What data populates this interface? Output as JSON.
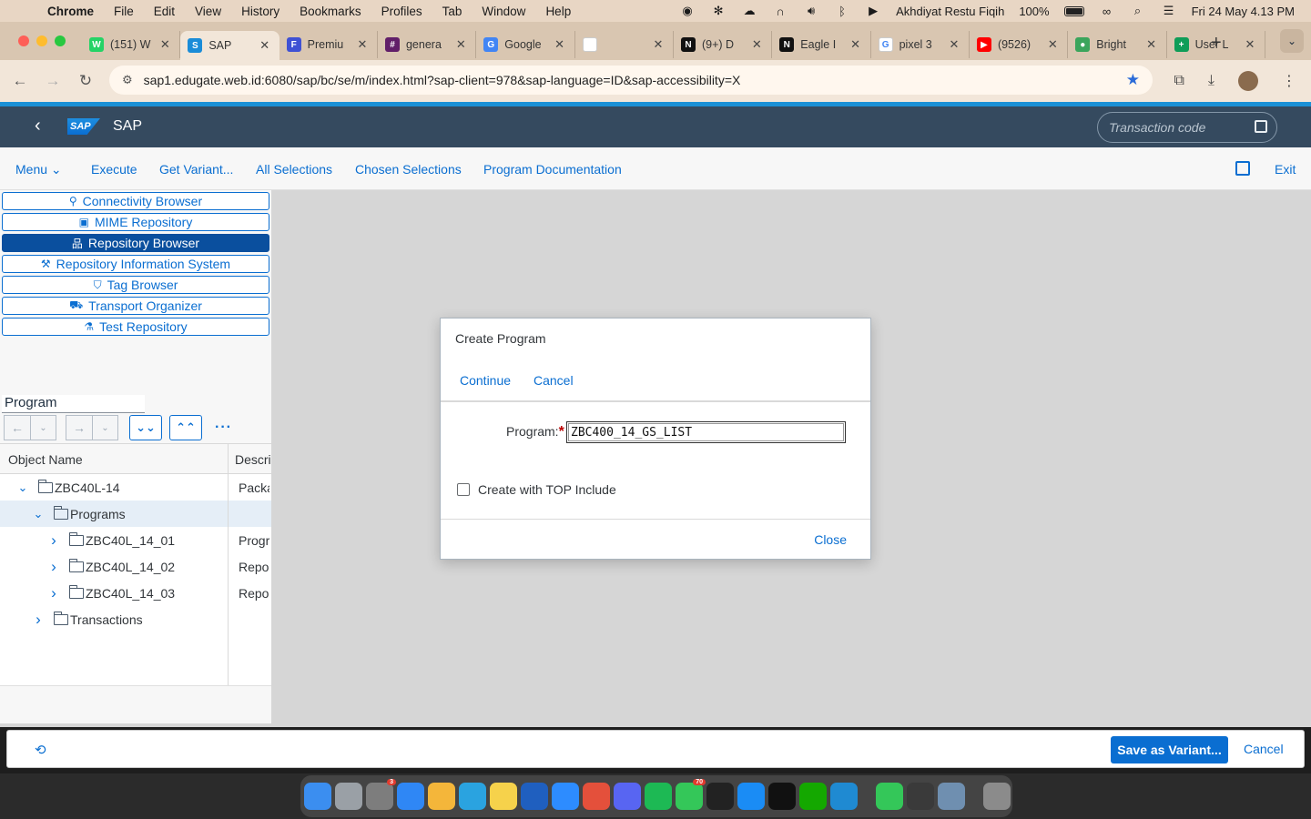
{
  "macos": {
    "menu": [
      "Chrome",
      "File",
      "Edit",
      "View",
      "History",
      "Bookmarks",
      "Profiles",
      "Tab",
      "Window",
      "Help"
    ],
    "user": "Akhdiyat Restu Fiqih",
    "battery": "100%",
    "datetime": "Fri 24 May  4.13 PM"
  },
  "browser": {
    "tabs": [
      {
        "title": "(151) W",
        "color": "#25d366",
        "glyph": "W"
      },
      {
        "title": "SAP",
        "color": "#1a8cd8",
        "glyph": "S"
      },
      {
        "title": "Premiu",
        "color": "#3f51d4",
        "glyph": "F"
      },
      {
        "title": "genera",
        "color": "#611f69",
        "glyph": "#"
      },
      {
        "title": "Google",
        "color": "#4285f4",
        "glyph": "G"
      },
      {
        "title": "",
        "color": "#ffffff",
        "glyph": ""
      },
      {
        "title": "(9+) D",
        "color": "#111111",
        "glyph": "N"
      },
      {
        "title": "Eagle I",
        "color": "#111111",
        "glyph": "N"
      },
      {
        "title": "pixel 3",
        "color": "#ffffff",
        "glyph": "G"
      },
      {
        "title": "(9526)",
        "color": "#ff0000",
        "glyph": "▶"
      },
      {
        "title": "Bright",
        "color": "#3ba55c",
        "glyph": "●"
      },
      {
        "title": "User L",
        "color": "#0f9d58",
        "glyph": "+"
      }
    ],
    "active_tab": 1,
    "url": "sap1.edugate.web.id:6080/sap/bc/se/m/index.html?sap-client=978&sap-language=ID&sap-accessibility=X"
  },
  "shell": {
    "logo": "SAP",
    "title": "SAP",
    "tcode_placeholder": "Transaction code"
  },
  "toolbar": {
    "menu": "Menu",
    "execute": "Execute",
    "get_variant": "Get Variant...",
    "all_selections": "All Selections",
    "chosen_selections": "Chosen Selections",
    "program_documentation": "Program Documentation",
    "exit": "Exit"
  },
  "nav_buttons": [
    {
      "label": "Connectivity Browser",
      "icon": "connectivity-icon",
      "selected": false
    },
    {
      "label": "MIME Repository",
      "icon": "mime-icon",
      "selected": false
    },
    {
      "label": "Repository Browser",
      "icon": "hierarchy-icon",
      "selected": true
    },
    {
      "label": "Repository Information System",
      "icon": "wrench-icon",
      "selected": false
    },
    {
      "label": "Tag Browser",
      "icon": "tag-icon",
      "selected": false
    },
    {
      "label": "Transport Organizer",
      "icon": "truck-icon",
      "selected": false
    },
    {
      "label": "Test Repository",
      "icon": "test-icon",
      "selected": false
    }
  ],
  "tree": {
    "object_type": "Program",
    "col_object_name": "Object Name",
    "col_description": "Descri",
    "rows": [
      {
        "name": "ZBC40L-14",
        "desc": "Packa",
        "level": 1,
        "expanded": true,
        "highlight": false
      },
      {
        "name": "Programs",
        "desc": "",
        "level": 2,
        "expanded": true,
        "highlight": true
      },
      {
        "name": "ZBC40L_14_01",
        "desc": "Progr",
        "level": 3,
        "expanded": false,
        "highlight": false
      },
      {
        "name": "ZBC40L_14_02",
        "desc": "Repor",
        "level": 3,
        "expanded": false,
        "highlight": false
      },
      {
        "name": "ZBC40L_14_03",
        "desc": "Repor",
        "level": 3,
        "expanded": false,
        "highlight": false
      },
      {
        "name": "Transactions",
        "desc": "",
        "level": 2,
        "expanded": false,
        "highlight": false
      }
    ]
  },
  "dialog": {
    "title": "Create Program",
    "continue": "Continue",
    "cancel": "Cancel",
    "program_label": "Program:",
    "program_value": "ZBC400_14_GS_LIST",
    "top_include_label": "Create with TOP Include",
    "top_include_checked": false,
    "close": "Close"
  },
  "actionbar": {
    "save_variant": "Save as Variant...",
    "cancel": "Cancel"
  },
  "dock": [
    {
      "name": "finder-icon",
      "color": "#3b8ef0"
    },
    {
      "name": "launchpad-icon",
      "color": "#9aa0a6"
    },
    {
      "name": "system-settings-icon",
      "color": "#7d7d7d",
      "badge": "3"
    },
    {
      "name": "mail-icon",
      "color": "#2f87f5"
    },
    {
      "name": "photos-icon",
      "color": "#f4b63a"
    },
    {
      "name": "telegram-icon",
      "color": "#2aa3e0"
    },
    {
      "name": "notes-icon",
      "color": "#f6d24b"
    },
    {
      "name": "word-icon",
      "color": "#1f5fbf"
    },
    {
      "name": "zoom-icon",
      "color": "#2d8cff"
    },
    {
      "name": "chrome-icon",
      "color": "#e4503b"
    },
    {
      "name": "discord-icon",
      "color": "#5865f2"
    },
    {
      "name": "spotify-icon",
      "color": "#1db954"
    },
    {
      "name": "messages-icon",
      "color": "#34c759",
      "badge": "70"
    },
    {
      "name": "figma-icon",
      "color": "#222222"
    },
    {
      "name": "app-store-icon",
      "color": "#1a8cf5"
    },
    {
      "name": "terminal-icon",
      "color": "#111111"
    },
    {
      "name": "upwork-icon",
      "color": "#14a800"
    },
    {
      "name": "vscode-icon",
      "color": "#1f8ad2"
    },
    {
      "name": "facetime-icon",
      "color": "#34c759"
    },
    {
      "name": "quicktime-icon",
      "color": "#3a3a3a"
    },
    {
      "name": "preview-icon",
      "color": "#6f8fb0"
    },
    {
      "name": "trash-icon",
      "color": "#8b8b8b"
    }
  ]
}
